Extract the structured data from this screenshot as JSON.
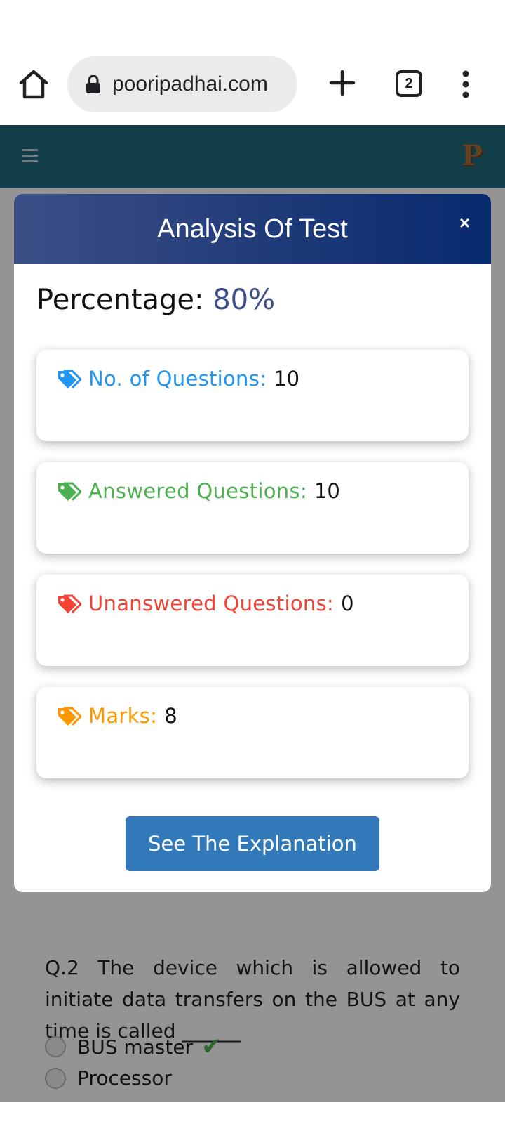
{
  "browser": {
    "url": "pooripadhai.com",
    "tab_count": "2"
  },
  "site": {
    "logo_letter": "P"
  },
  "background_question": {
    "text": "Q.2 The device which is allowed to initiate data transfers on the BUS at any time is called ______",
    "options": [
      "BUS master",
      "Processor"
    ],
    "correct_index": 0
  },
  "modal": {
    "title": "Analysis Of Test",
    "close_label": "×",
    "percentage_label": "Percentage:",
    "percentage_value": "80%",
    "stats": [
      {
        "label": "No. of Questions:",
        "value": "10",
        "color": "#2196f3",
        "icon": "tag-icon"
      },
      {
        "label": "Answered Questions:",
        "value": "10",
        "color": "#4caf50",
        "icon": "tag-icon"
      },
      {
        "label": "Unanswered Questions:",
        "value": "0",
        "color": "#f44336",
        "icon": "tag-icon"
      },
      {
        "label": "Marks:",
        "value": "8",
        "color": "#ff9800",
        "icon": "tag-icon"
      }
    ],
    "explain_button": "See The Explanation"
  },
  "colors": {
    "header_bg": "#1f6c80",
    "modal_header_start": "#3d4f87",
    "modal_header_end": "#072a6e",
    "button_bg": "#3279b9"
  }
}
